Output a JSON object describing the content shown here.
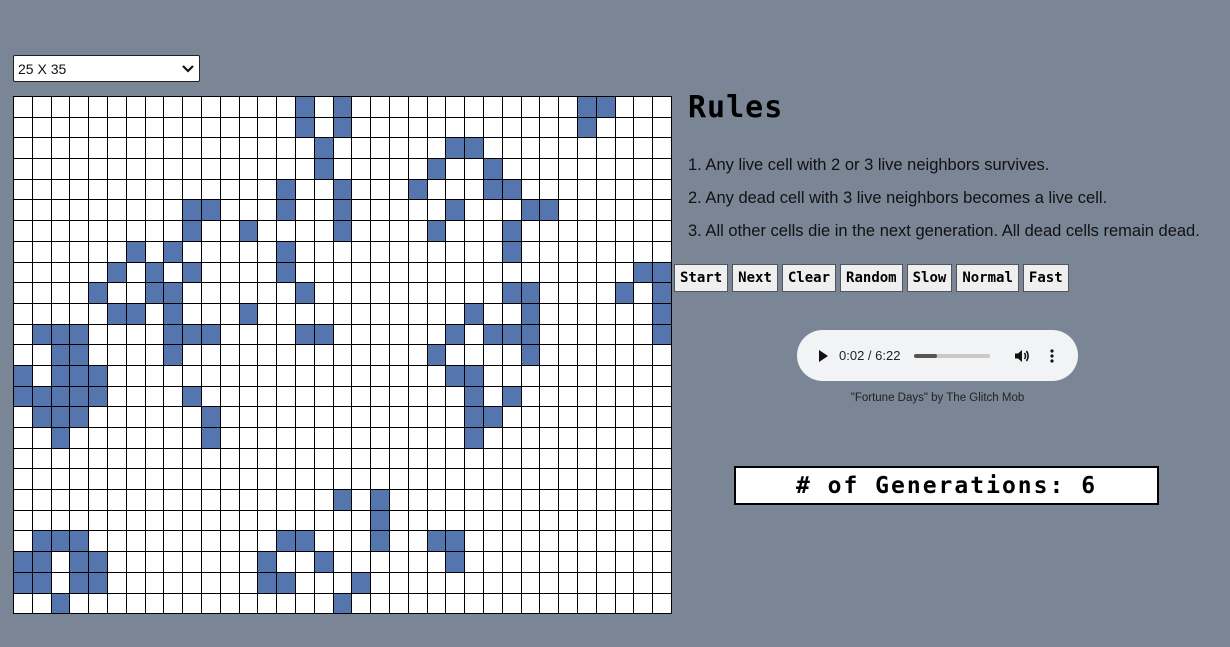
{
  "grid_select": {
    "value": "25 X 35"
  },
  "grid": {
    "rows": 25,
    "cols": 35,
    "alive_color": "#5475ad",
    "dead_color": "#ffffff",
    "alive": [
      [
        0,
        15
      ],
      [
        0,
        17
      ],
      [
        0,
        30
      ],
      [
        0,
        31
      ],
      [
        1,
        15
      ],
      [
        1,
        17
      ],
      [
        1,
        30
      ],
      [
        2,
        16
      ],
      [
        2,
        23
      ],
      [
        2,
        24
      ],
      [
        3,
        16
      ],
      [
        3,
        22
      ],
      [
        3,
        25
      ],
      [
        4,
        14
      ],
      [
        4,
        17
      ],
      [
        4,
        21
      ],
      [
        4,
        25
      ],
      [
        4,
        26
      ],
      [
        5,
        9
      ],
      [
        5,
        10
      ],
      [
        5,
        14
      ],
      [
        5,
        17
      ],
      [
        5,
        23
      ],
      [
        5,
        27
      ],
      [
        5,
        28
      ],
      [
        6,
        9
      ],
      [
        6,
        12
      ],
      [
        6,
        17
      ],
      [
        6,
        22
      ],
      [
        6,
        26
      ],
      [
        7,
        6
      ],
      [
        7,
        8
      ],
      [
        7,
        14
      ],
      [
        7,
        26
      ],
      [
        8,
        5
      ],
      [
        8,
        7
      ],
      [
        8,
        9
      ],
      [
        8,
        14
      ],
      [
        8,
        33
      ],
      [
        8,
        34
      ],
      [
        9,
        4
      ],
      [
        9,
        7
      ],
      [
        9,
        8
      ],
      [
        9,
        15
      ],
      [
        9,
        26
      ],
      [
        9,
        27
      ],
      [
        9,
        32
      ],
      [
        9,
        34
      ],
      [
        10,
        5
      ],
      [
        10,
        6
      ],
      [
        10,
        8
      ],
      [
        10,
        12
      ],
      [
        10,
        24
      ],
      [
        10,
        27
      ],
      [
        10,
        34
      ],
      [
        11,
        1
      ],
      [
        11,
        2
      ],
      [
        11,
        3
      ],
      [
        11,
        8
      ],
      [
        11,
        9
      ],
      [
        11,
        10
      ],
      [
        11,
        15
      ],
      [
        11,
        16
      ],
      [
        11,
        23
      ],
      [
        11,
        25
      ],
      [
        11,
        26
      ],
      [
        11,
        27
      ],
      [
        11,
        34
      ],
      [
        12,
        2
      ],
      [
        12,
        3
      ],
      [
        12,
        8
      ],
      [
        12,
        22
      ],
      [
        12,
        27
      ],
      [
        13,
        0
      ],
      [
        13,
        2
      ],
      [
        13,
        3
      ],
      [
        13,
        4
      ],
      [
        13,
        23
      ],
      [
        13,
        24
      ],
      [
        14,
        0
      ],
      [
        14,
        1
      ],
      [
        14,
        2
      ],
      [
        14,
        3
      ],
      [
        14,
        4
      ],
      [
        14,
        9
      ],
      [
        14,
        24
      ],
      [
        14,
        26
      ],
      [
        15,
        1
      ],
      [
        15,
        2
      ],
      [
        15,
        3
      ],
      [
        15,
        10
      ],
      [
        15,
        24
      ],
      [
        15,
        25
      ],
      [
        16,
        2
      ],
      [
        16,
        10
      ],
      [
        16,
        24
      ],
      [
        19,
        17
      ],
      [
        19,
        19
      ],
      [
        20,
        19
      ],
      [
        21,
        1
      ],
      [
        21,
        2
      ],
      [
        21,
        3
      ],
      [
        21,
        14
      ],
      [
        21,
        15
      ],
      [
        21,
        19
      ],
      [
        21,
        22
      ],
      [
        21,
        23
      ],
      [
        22,
        0
      ],
      [
        22,
        1
      ],
      [
        22,
        3
      ],
      [
        22,
        4
      ],
      [
        22,
        13
      ],
      [
        22,
        16
      ],
      [
        22,
        23
      ],
      [
        23,
        0
      ],
      [
        23,
        1
      ],
      [
        23,
        3
      ],
      [
        23,
        4
      ],
      [
        23,
        13
      ],
      [
        23,
        14
      ],
      [
        23,
        18
      ],
      [
        24,
        2
      ],
      [
        24,
        17
      ]
    ]
  },
  "rules": {
    "title": "Rules",
    "items": [
      "1. Any live cell with 2 or 3 live neighbors survives.",
      "2. Any dead cell with 3 live neighbors becomes a live cell.",
      "3. All other cells die in the next generation. All dead cells remain dead."
    ]
  },
  "controls": {
    "start": "Start",
    "next": "Next",
    "clear": "Clear",
    "random": "Random",
    "slow": "Slow",
    "normal": "Normal",
    "fast": "Fast"
  },
  "audio": {
    "time": "0:02 / 6:22",
    "progress": 0.3,
    "credit": "\"Fortune Days\" by The Glitch Mob"
  },
  "generations": {
    "label": "# of Generations: ",
    "count": "6"
  }
}
